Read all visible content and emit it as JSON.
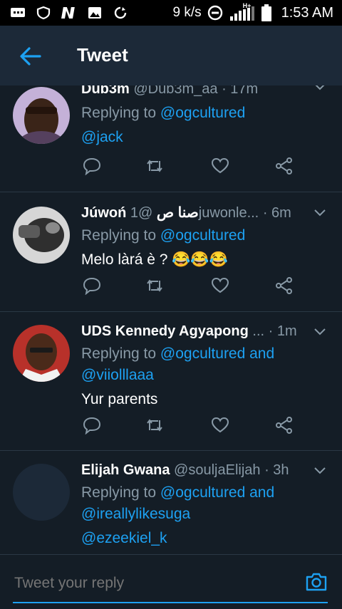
{
  "status_bar": {
    "network_speed": "9 k/s",
    "network_type": "H+",
    "time": "1:53 AM"
  },
  "app_bar": {
    "title": "Tweet"
  },
  "replies": [
    {
      "name": "Dub3m",
      "handle": "@Dub3m_aa",
      "time": "· 17m",
      "replying_prefix": "Replying to ",
      "replying_handle": "@ogcultured",
      "extra_mention": "@jack",
      "text": ""
    },
    {
      "name": "Júwoń صنا ص",
      "handle": "@1juwonle...",
      "time": "· 6m",
      "replying_prefix": "Replying to ",
      "replying_handle": "@ogcultured",
      "extra_mention": "",
      "text": "Melo làrá è ? 😂😂😂"
    },
    {
      "name": "UDS Kennedy Agyapong",
      "handle": "...",
      "time": "· 1m",
      "replying_prefix": "Replying to ",
      "replying_handle": "@ogcultured and",
      "extra_mention": "@viiolllaaa",
      "text": "Yur parents"
    },
    {
      "name": "Elijah Gwana",
      "handle": "@souljaElijah",
      "time": "· 3h",
      "replying_prefix": "Replying to ",
      "replying_handle": "@ogcultured and",
      "extra_mention": "@ireallylikesuga",
      "text": "@ezeekiel_k"
    }
  ],
  "compose": {
    "placeholder": "Tweet your reply"
  },
  "colors": {
    "background": "#141d26",
    "app_bar": "#1c2938",
    "accent": "#1da1f2",
    "muted_text": "#8899a6"
  }
}
